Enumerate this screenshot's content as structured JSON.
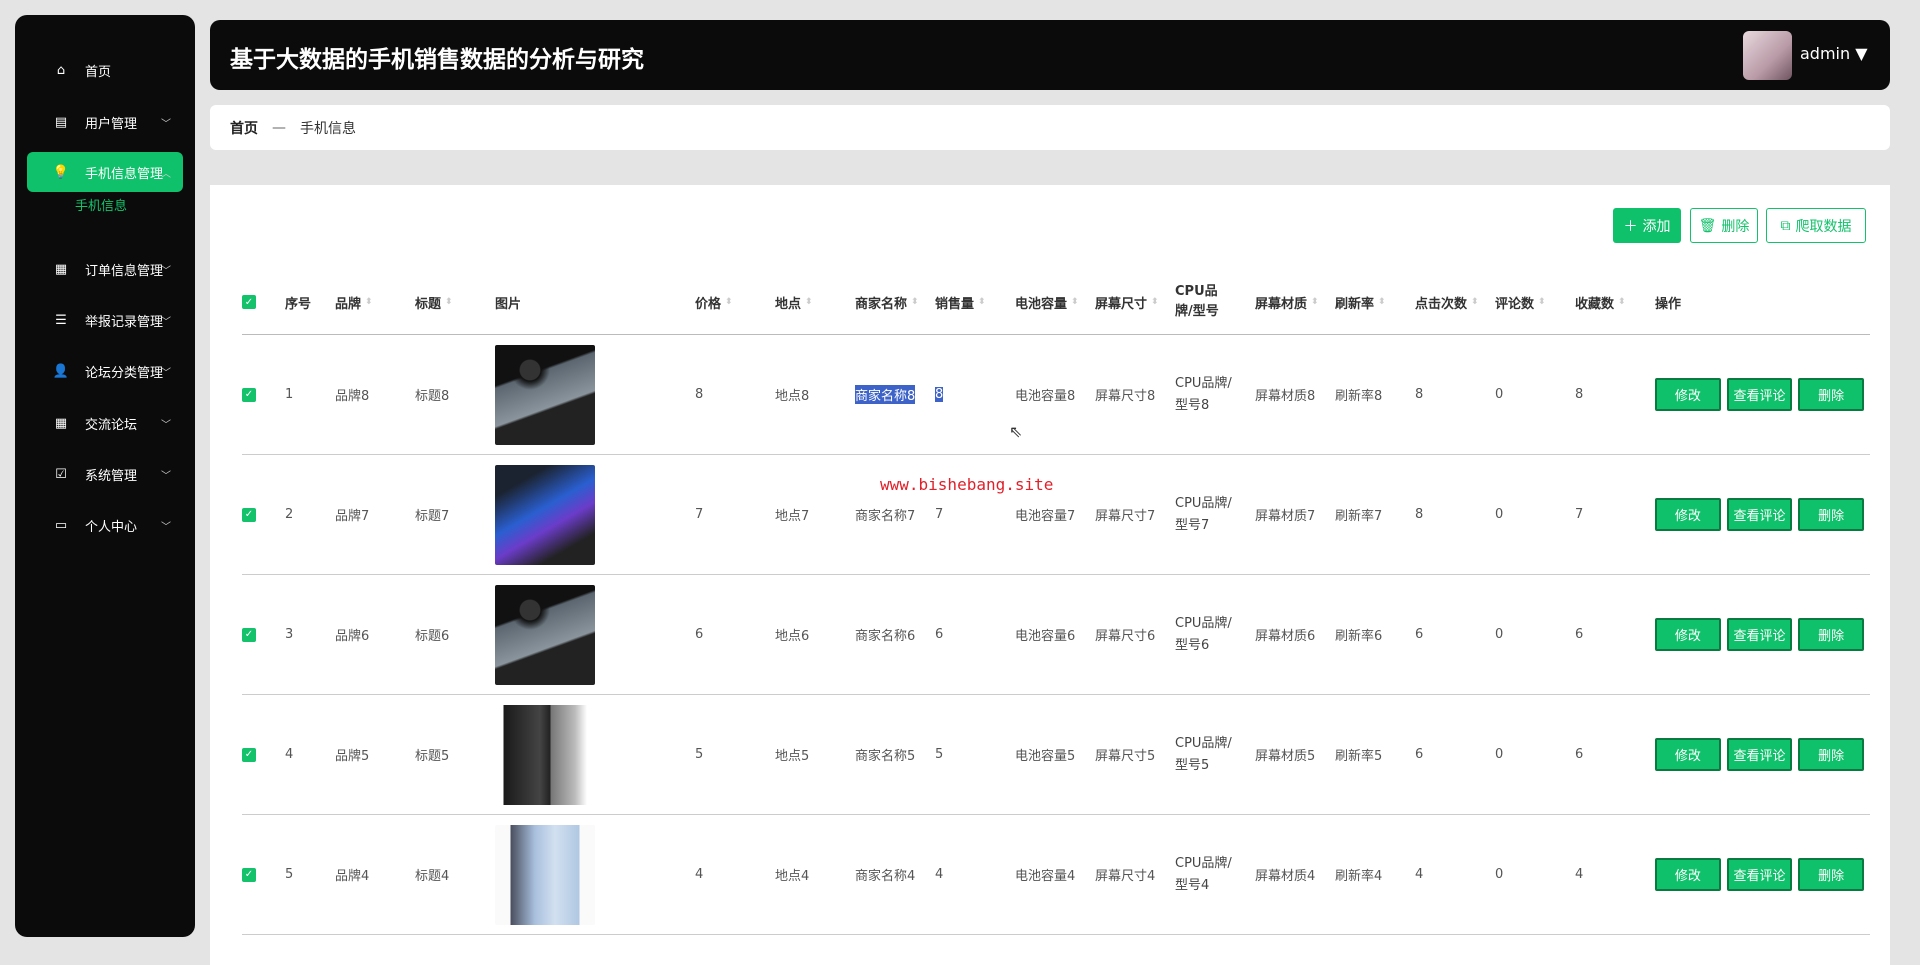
{
  "sidebar": {
    "items": [
      {
        "label": "首页",
        "icon": "home-icon",
        "expanded": null
      },
      {
        "label": "用户管理",
        "icon": "clipboard-icon",
        "expanded": false
      },
      {
        "label": "手机信息管理",
        "icon": "lightbulb-icon",
        "expanded": true,
        "active": true
      },
      {
        "label": "订单信息管理",
        "icon": "grid-icon",
        "expanded": false
      },
      {
        "label": "举报记录管理",
        "icon": "list-icon",
        "expanded": false
      },
      {
        "label": "论坛分类管理",
        "icon": "user-icon",
        "expanded": false
      },
      {
        "label": "交流论坛",
        "icon": "grid-icon",
        "expanded": false
      },
      {
        "label": "系统管理",
        "icon": "checklist-icon",
        "expanded": false
      },
      {
        "label": "个人中心",
        "icon": "card-icon",
        "expanded": false
      }
    ],
    "sub_item": "手机信息"
  },
  "header": {
    "title": "基于大数据的手机销售数据的分析与研究",
    "user": "admin"
  },
  "breadcrumb": {
    "home": "首页",
    "sep": "—",
    "current": "手机信息"
  },
  "toolbar": {
    "add": "添加",
    "delete": "删除",
    "crawl": "爬取数据"
  },
  "table": {
    "columns": [
      "序号",
      "品牌",
      "标题",
      "图片",
      "价格",
      "地点",
      "商家名称",
      "销售量",
      "电池容量",
      "屏幕尺寸",
      "CPU品牌/型号",
      "屏幕材质",
      "刷新率",
      "点击次数",
      "评论数",
      "收藏数",
      "操作"
    ],
    "sortable": [
      false,
      true,
      true,
      false,
      true,
      true,
      true,
      true,
      true,
      true,
      false,
      true,
      true,
      true,
      true,
      true,
      false
    ],
    "actions": {
      "edit": "修改",
      "comments": "查看评论",
      "delete": "删除"
    },
    "rows": [
      {
        "no": "1",
        "brand": "品牌8",
        "title": "标题8",
        "image": "dark-phone",
        "price": "8",
        "place": "地点8",
        "merchant": "商家名称8",
        "sales": "8",
        "battery": "电池容量8",
        "screen": "屏幕尺寸8",
        "cpu": "CPU品牌/型号8",
        "material": "屏幕材质8",
        "refresh": "刷新率8",
        "clicks": "8",
        "comments": "0",
        "favorites": "8",
        "checked": true
      },
      {
        "no": "2",
        "brand": "品牌7",
        "title": "标题7",
        "image": "blue-phone",
        "price": "7",
        "place": "地点7",
        "merchant": "商家名称7",
        "sales": "7",
        "battery": "电池容量7",
        "screen": "屏幕尺寸7",
        "cpu": "CPU品牌/型号7",
        "material": "屏幕材质7",
        "refresh": "刷新率7",
        "clicks": "8",
        "comments": "0",
        "favorites": "7",
        "checked": true
      },
      {
        "no": "3",
        "brand": "品牌6",
        "title": "标题6",
        "image": "dark-phone",
        "price": "6",
        "place": "地点6",
        "merchant": "商家名称6",
        "sales": "6",
        "battery": "电池容量6",
        "screen": "屏幕尺寸6",
        "cpu": "CPU品牌/型号6",
        "material": "屏幕材质6",
        "refresh": "刷新率6",
        "clicks": "6",
        "comments": "0",
        "favorites": "6",
        "checked": true
      },
      {
        "no": "4",
        "brand": "品牌5",
        "title": "标题5",
        "image": "black-phone",
        "price": "5",
        "place": "地点5",
        "merchant": "商家名称5",
        "sales": "5",
        "battery": "电池容量5",
        "screen": "屏幕尺寸5",
        "cpu": "CPU品牌/型号5",
        "material": "屏幕材质5",
        "refresh": "刷新率5",
        "clicks": "6",
        "comments": "0",
        "favorites": "6",
        "checked": true
      },
      {
        "no": "5",
        "brand": "品牌4",
        "title": "标题4",
        "image": "light-blue-phone",
        "price": "4",
        "place": "地点4",
        "merchant": "商家名称4",
        "sales": "4",
        "battery": "电池容量4",
        "screen": "屏幕尺寸4",
        "cpu": "CPU品牌/型号4",
        "material": "屏幕材质4",
        "refresh": "刷新率4",
        "clicks": "4",
        "comments": "0",
        "favorites": "4",
        "checked": true
      }
    ]
  },
  "watermark": "www.bishebang.site",
  "colors": {
    "accent": "#0fc16a",
    "sidebar": "#0b0b0b",
    "selection": "#3e63c8",
    "watermark": "#e0202a"
  }
}
